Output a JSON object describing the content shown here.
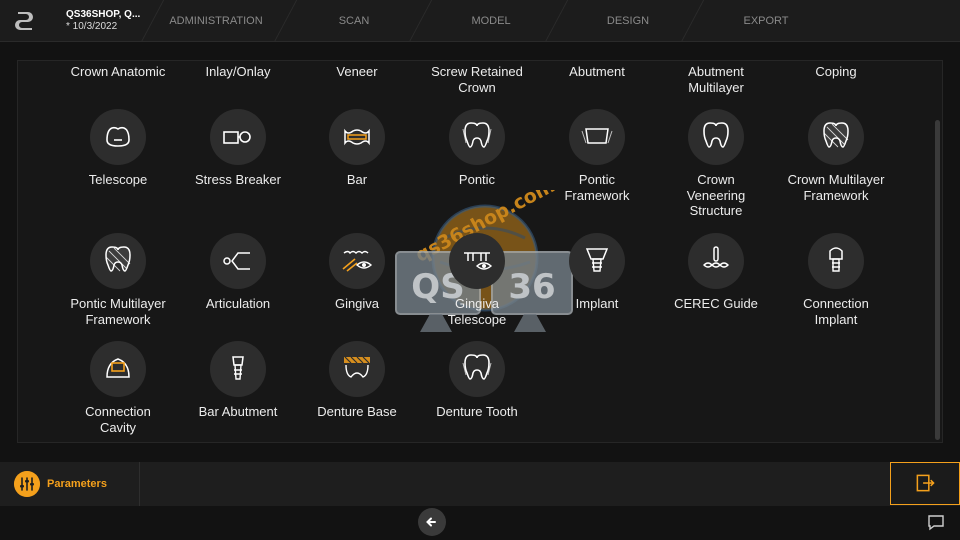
{
  "header": {
    "case_name": "QS36SHOP, Q...",
    "case_date": "* 10/3/2022",
    "steps": [
      "ADMINISTRATION",
      "SCAN",
      "MODEL",
      "DESIGN",
      "EXPORT"
    ]
  },
  "restorations": {
    "row0": [
      {
        "label": "Crown Anatomic"
      },
      {
        "label": "Inlay/Onlay"
      },
      {
        "label": "Veneer"
      },
      {
        "label": "Screw Retained\nCrown"
      },
      {
        "label": "Abutment"
      },
      {
        "label": "Abutment\nMultilayer"
      },
      {
        "label": "Coping"
      }
    ],
    "row1": [
      {
        "label": "Telescope",
        "icon": "telescope-icon"
      },
      {
        "label": "Stress Breaker",
        "icon": "stress-breaker-icon"
      },
      {
        "label": "Bar",
        "icon": "bar-icon"
      },
      {
        "label": "Pontic",
        "icon": "pontic-icon"
      },
      {
        "label": "Pontic\nFramework",
        "icon": "pontic-framework-icon"
      },
      {
        "label": "Crown\nVeneering\nStructure",
        "icon": "crown-veneering-icon"
      },
      {
        "label": "Crown Multilayer\nFramework",
        "icon": "crown-multilayer-icon"
      }
    ],
    "row2": [
      {
        "label": "Pontic Multilayer\nFramework",
        "icon": "pontic-multilayer-icon"
      },
      {
        "label": "Articulation",
        "icon": "articulation-icon"
      },
      {
        "label": "Gingiva",
        "icon": "gingiva-icon"
      },
      {
        "label": "Gingiva\nTelescope",
        "icon": "gingiva-telescope-icon"
      },
      {
        "label": "Implant",
        "icon": "implant-icon"
      },
      {
        "label": "CEREC Guide",
        "icon": "cerec-guide-icon"
      },
      {
        "label": "Connection\nImplant",
        "icon": "connection-implant-icon"
      }
    ],
    "row3": [
      {
        "label": "Connection\nCavity",
        "icon": "connection-cavity-icon"
      },
      {
        "label": "Bar Abutment",
        "icon": "bar-abutment-icon"
      },
      {
        "label": "Denture Base",
        "icon": "denture-base-icon"
      },
      {
        "label": "Denture Tooth",
        "icon": "denture-tooth-icon"
      }
    ]
  },
  "watermark": {
    "site": "qs36shop.com",
    "brand_left": "QS",
    "brand_right": "36"
  },
  "toolbar": {
    "parameters_label": "Parameters"
  },
  "colors": {
    "accent": "#f4a01c",
    "background": "#121212",
    "icon_circle": "#2d2d2d"
  }
}
